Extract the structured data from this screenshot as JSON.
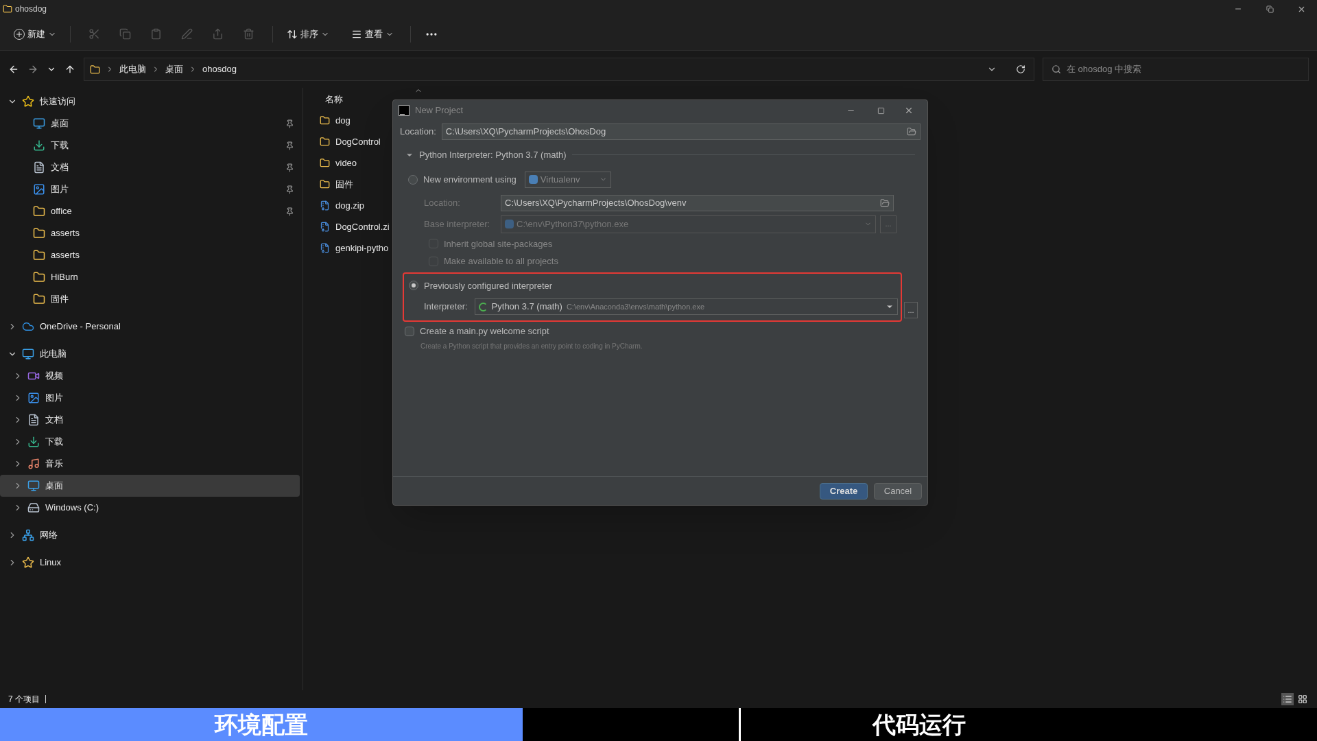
{
  "window": {
    "title": "ohosdog"
  },
  "toolbar": {
    "new": "新建",
    "sort": "排序",
    "view": "查看"
  },
  "address": {
    "crumbs": [
      "此电脑",
      "桌面",
      "ohosdog"
    ],
    "search_placeholder": "在 ohosdog 中搜索"
  },
  "sidebar": {
    "items": [
      {
        "label": "快速访问",
        "kind": "star",
        "expanded": true,
        "selected": false,
        "children": [
          {
            "label": "桌面",
            "kind": "desktop",
            "pinned": true,
            "selected": false
          },
          {
            "label": "下载",
            "kind": "download",
            "pinned": true,
            "selected": false
          },
          {
            "label": "文档",
            "kind": "document",
            "pinned": true,
            "selected": false
          },
          {
            "label": "图片",
            "kind": "picture",
            "pinned": true,
            "selected": false
          },
          {
            "label": "office",
            "kind": "folder",
            "pinned": true,
            "selected": false
          },
          {
            "label": "asserts",
            "kind": "folder",
            "pinned": false,
            "selected": false
          },
          {
            "label": "asserts",
            "kind": "folder",
            "pinned": false,
            "selected": false
          },
          {
            "label": "HiBurn",
            "kind": "folder",
            "pinned": false,
            "selected": false
          },
          {
            "label": "固件",
            "kind": "folder",
            "pinned": false,
            "selected": false
          }
        ]
      },
      {
        "label": "OneDrive - Personal",
        "kind": "cloud",
        "expanded": false,
        "selected": false
      },
      {
        "label": "此电脑",
        "kind": "monitor",
        "expanded": true,
        "selected": false,
        "children": [
          {
            "label": "视频",
            "kind": "video",
            "expanded": false,
            "selected": false
          },
          {
            "label": "图片",
            "kind": "picture",
            "expanded": false,
            "selected": false
          },
          {
            "label": "文档",
            "kind": "document",
            "expanded": false,
            "selected": false
          },
          {
            "label": "下载",
            "kind": "download",
            "expanded": false,
            "selected": false
          },
          {
            "label": "音乐",
            "kind": "music",
            "expanded": false,
            "selected": false
          },
          {
            "label": "桌面",
            "kind": "desktop",
            "expanded": false,
            "selected": true
          },
          {
            "label": "Windows (C:)",
            "kind": "drive",
            "expanded": false,
            "selected": false
          }
        ]
      },
      {
        "label": "网络",
        "kind": "network",
        "expanded": false,
        "selected": false
      },
      {
        "label": "Linux",
        "kind": "linux",
        "expanded": false,
        "selected": false
      }
    ]
  },
  "file_list": {
    "columns": [
      "名称"
    ],
    "rows": [
      {
        "name": "dog",
        "kind": "folder"
      },
      {
        "name": "DogControl",
        "kind": "folder"
      },
      {
        "name": "video",
        "kind": "folder"
      },
      {
        "name": "固件",
        "kind": "folder"
      },
      {
        "name": "dog.zip",
        "kind": "zip"
      },
      {
        "name": "DogControl.zi",
        "kind": "zip"
      },
      {
        "name": "genkipi-pytho",
        "kind": "zip"
      }
    ]
  },
  "status_bar": {
    "count": "7 个项目"
  },
  "dialog": {
    "title": "New Project",
    "location_label": "Location:",
    "location": "C:\\Users\\XQ\\PycharmProjects\\OhosDog",
    "section": {
      "label": "Python Interpreter: Python 3.7 (math)",
      "expanded": true
    },
    "new_env": {
      "label": "New environment using",
      "selected": false,
      "tool": "Virtualenv",
      "location_label": "Location:",
      "location": "C:\\Users\\XQ\\PycharmProjects\\OhosDog\\venv",
      "base_label": "Base interpreter:",
      "base": "C:\\env\\Python37\\python.exe",
      "more": "...",
      "options": [
        {
          "label": "Inherit global site-packages",
          "checked": false,
          "disabled": true
        },
        {
          "label": "Make available to all projects",
          "checked": false,
          "disabled": true
        }
      ]
    },
    "previous": {
      "label": "Previously configured interpreter",
      "selected": true,
      "highlighted": true,
      "interpreter_label": "Interpreter:",
      "interpreter": "Python 3.7 (math)",
      "interpreter_path": "C:\\env\\Anaconda3\\envs\\math\\python.exe",
      "more": "..."
    },
    "welcome": {
      "label": "Create a main.py welcome script",
      "checked": false,
      "hint": "Create a Python script that provides an entry point to coding in PyCharm."
    },
    "buttons": [
      {
        "label": "Create",
        "kind": "primary"
      },
      {
        "label": "Cancel",
        "kind": "secondary"
      }
    ]
  },
  "chapters": [
    {
      "label": "环境配置",
      "selected": true
    },
    {
      "label": "代码运行",
      "selected": false
    }
  ]
}
